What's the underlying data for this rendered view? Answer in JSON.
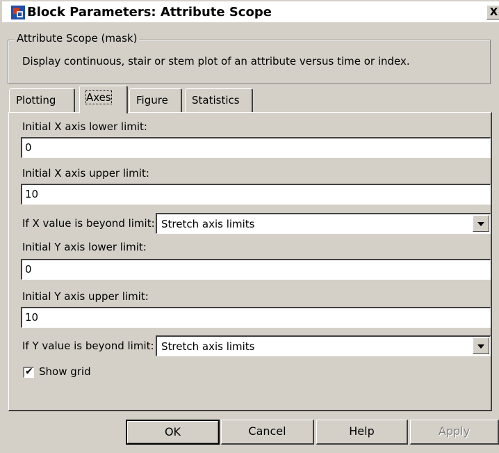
{
  "window": {
    "title": "Block Parameters: Attribute Scope",
    "close_label": "X"
  },
  "mask": {
    "group_title": "Attribute Scope (mask)",
    "description": "Display continuous, stair or stem plot of an attribute versus time or index."
  },
  "tabs": [
    {
      "label": "Plotting",
      "active": false
    },
    {
      "label": "Axes",
      "active": true
    },
    {
      "label": "Figure",
      "active": false
    },
    {
      "label": "Statistics",
      "active": false
    }
  ],
  "axes": {
    "x_lower_label": "Initial X axis lower limit:",
    "x_lower_value": "0",
    "x_upper_label": "Initial X axis upper limit:",
    "x_upper_value": "10",
    "x_beyond_label": "If X value is beyond limit:",
    "x_beyond_value": "Stretch axis limits",
    "y_lower_label": "Initial Y axis lower limit:",
    "y_lower_value": "0",
    "y_upper_label": "Initial Y axis upper limit:",
    "y_upper_value": "10",
    "y_beyond_label": "If Y value is beyond limit:",
    "y_beyond_value": "Stretch axis limits",
    "show_grid_label": "Show grid",
    "show_grid_checked": true
  },
  "buttons": {
    "ok": "OK",
    "cancel": "Cancel",
    "help": "Help",
    "apply": "Apply"
  }
}
